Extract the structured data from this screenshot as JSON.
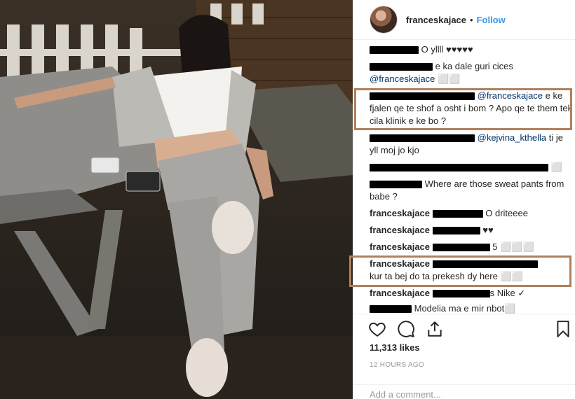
{
  "post": {
    "username": "franceskajace",
    "separator": "•",
    "follow_label": "Follow"
  },
  "comments": [
    {
      "user": "",
      "text": "O yllll ♥♥♥♥♥"
    },
    {
      "user": "",
      "text": "e ka dale guri cices"
    },
    {
      "user": "",
      "mention": "@franceskajace",
      "text": " ⬜⬜"
    },
    {
      "user": "",
      "mention": "@franceskajace",
      "text": " e ke fjalen qe te shof a osht i bom ? Apo qe te them tek cila klinik e ke bo ?"
    },
    {
      "user": "",
      "mention": "@kejvina_kthella",
      "text": " ti je yll moj jo kjo"
    },
    {
      "user": "",
      "text": "⬜"
    },
    {
      "user": "",
      "text": "Where are those sweat pants from babe ?"
    },
    {
      "user": "franceskajace",
      "text": "O driteeee"
    },
    {
      "user": "franceskajace",
      "text": "♥♥"
    },
    {
      "user": "franceskajace",
      "text": "5 ⬜⬜⬜"
    },
    {
      "user": "franceskajace",
      "text": "kur ta bej do ta prekesh dy here ⬜⬜"
    },
    {
      "user": "franceskajace",
      "text": "s Nike ✓"
    },
    {
      "user": "",
      "text": "Modelia ma e mir nbot⬜"
    }
  ],
  "actions": {
    "like_icon": "heart-icon",
    "comment_icon": "comment-bubble-icon",
    "share_icon": "share-icon",
    "save_icon": "bookmark-icon"
  },
  "likes_text": "11,313 likes",
  "time_text": "12 HOURS AGO",
  "comment_input": {
    "placeholder": "Add a comment..."
  },
  "colors": {
    "accent": "#3897f0",
    "highlight_border": "#b0805b"
  }
}
